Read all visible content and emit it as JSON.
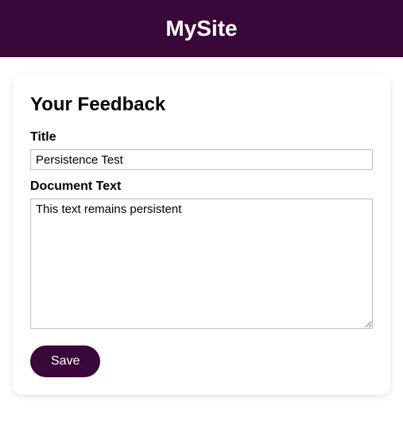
{
  "header": {
    "site_name": "MySite"
  },
  "form": {
    "heading": "Your Feedback",
    "title_label": "Title",
    "title_value": "Persistence Test",
    "text_label": "Document Text",
    "text_value": "This text remains persistent",
    "save_label": "Save"
  },
  "colors": {
    "brand": "#3a073a"
  }
}
